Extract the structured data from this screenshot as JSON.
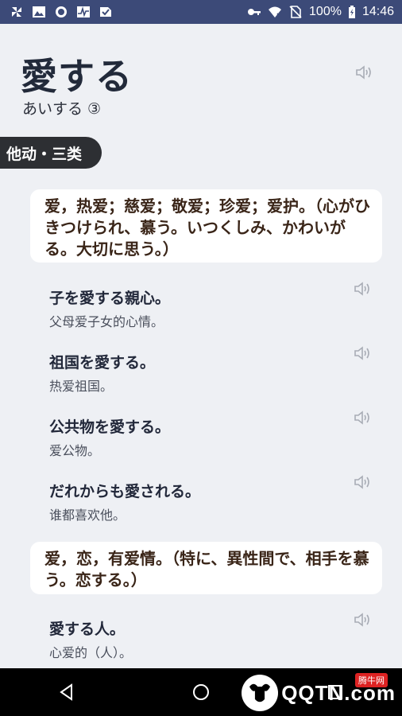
{
  "status_bar": {
    "battery": "100%",
    "time": "14:46",
    "left_icons": [
      "pinwheel-icon",
      "image-icon",
      "circle-app-icon",
      "activity-icon",
      "check-box-icon"
    ],
    "right_icons": [
      "key-icon",
      "wifi-icon",
      "no-sim-icon",
      "battery-icon"
    ]
  },
  "entry": {
    "word": "愛する",
    "reading": "あいする ③",
    "part_of_speech": "他动・三类"
  },
  "definitions": [
    {
      "text": "爱，热爱；慈爱；敬爱；珍爱；爱护。（心がひきつけられ、慕う。いつくしみ、かわいがる。大切に思う。）",
      "examples": [
        {
          "jp": "子を愛する親心。",
          "cn": "父母爱子女的心情。"
        },
        {
          "jp": "祖国を愛する。",
          "cn": "热爱祖国。"
        },
        {
          "jp": "公共物を愛する。",
          "cn": "爱公物。"
        },
        {
          "jp": "だれからも愛される。",
          "cn": "谁都喜欢他。"
        }
      ]
    },
    {
      "text": "爱，恋，有爱情。（特に、異性間で、相手を慕う。恋する。）",
      "examples": [
        {
          "jp": "愛する人。",
          "cn": "心爱的（人）。"
        }
      ]
    }
  ],
  "watermark": {
    "text": "QQTN.com",
    "badge": "腾牛网"
  },
  "colors": {
    "status_bar": "#3c4a78",
    "background": "#eef0f4",
    "tag": "#2d2f33",
    "card": "#ffffff"
  }
}
